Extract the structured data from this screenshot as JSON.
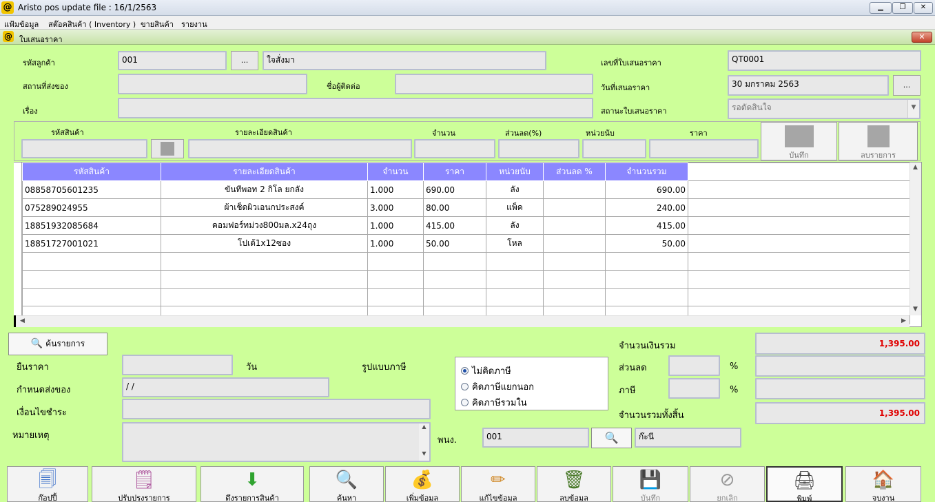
{
  "app": {
    "title": "Aristo pos  update file : 16/1/2563",
    "icon_glyph": "@",
    "window_controls": [
      "minimize",
      "restore",
      "close"
    ]
  },
  "menu": [
    "แฟ้มข้อมูล",
    "สต๊อคสินค้า ( Inventory )",
    "ขายสินค้า",
    "รายงาน"
  ],
  "child_window": {
    "title": "ใบเสนอราคา",
    "close_glyph": "✕"
  },
  "header": {
    "customer_code_label": "รหัสลูกค้า",
    "customer_code": "001",
    "customer_browse": "...",
    "customer_name": "ใจสั่งมา",
    "quote_no_label": "เลขที่ใบเสนอราคา",
    "quote_no": "QT0001",
    "delivery_place_label": "สถานที่ส่งของ",
    "delivery_place": "",
    "contact_label": "ชื่อผู้ติดต่อ",
    "contact": "",
    "quote_date_label": "วันที่เสนอราคา",
    "quote_date": "30 มกราคม 2563",
    "date_browse": "...",
    "subject_label": "เรื่อง",
    "subject": "",
    "status_label": "สถานะใบเสนอราคา",
    "status": "รอตัดสินใจ"
  },
  "entry": {
    "code_label": "รหัสสินค้า",
    "desc_label": "รายละเอียดสินค้า",
    "qty_label": "จำนวน",
    "discount_label": "ส่วนลด(%)",
    "unit_label": "หน่วยนับ",
    "price_label": "ราคา",
    "save_label": "บันทึก",
    "delete_label": "ลบรายการ"
  },
  "grid": {
    "columns": [
      "รหัสสินค้า",
      "รายละเอียดสินค้า",
      "จำนวน",
      "ราคา",
      "หน่วยนับ",
      "ส่วนลด %",
      "จำนวนรวม"
    ],
    "rows": [
      [
        "08858705601235",
        "ขันทีพอท 2 กิโล ยกลัง",
        "1.000",
        "690.00",
        "ลัง",
        "",
        "690.00"
      ],
      [
        "075289024955",
        "ผ้าเช็ดผิวเอนกประสงค์",
        "3.000",
        "80.00",
        "แพ็ค",
        "",
        "240.00"
      ],
      [
        "18851932085684",
        "คอมฟอร์ทม่วง800มล.x24ถุง",
        "1.000",
        "415.00",
        "ลัง",
        "",
        "415.00"
      ],
      [
        "18851727001021",
        "โปเต้1x12ซอง",
        "1.000",
        "50.00",
        "โหล",
        "",
        "50.00"
      ],
      [
        "",
        "",
        "",
        "",
        "",
        "",
        ""
      ],
      [
        "",
        "",
        "",
        "",
        "",
        "",
        ""
      ],
      [
        "",
        "",
        "",
        "",
        "",
        "",
        ""
      ],
      [
        "",
        "",
        "",
        "",
        "",
        "",
        ""
      ]
    ]
  },
  "lower": {
    "find_items_label": "ค้นรายการ",
    "price_valid_label": "ยืนราคา",
    "price_valid": "",
    "days_label": "วัน",
    "tax_type_label": "รูปแบบภาษี",
    "delivery_due_label": "กำหนดส่งของ",
    "delivery_due": " /  /",
    "payment_terms_label": "เงื่อนไขชำระ",
    "payment_terms": "",
    "remark_label": "หมายเหตุ",
    "remark": "",
    "tax_options": [
      "ไม่คิดภาษี",
      "คิดภาษีแยกนอก",
      "คิดภาษีรวมใน"
    ],
    "tax_selected": 0,
    "employee_label": "พนง.",
    "employee_code": "001",
    "employee_name": "ก๊ะนี",
    "total_label": "จำนวนเงินรวม",
    "total": "1,395.00",
    "discount_label": "ส่วนลด",
    "discount_pct": "",
    "discount_amt": "",
    "vat_label": "ภาษี",
    "vat_pct": "",
    "vat_amt": "",
    "percent": "%",
    "grand_total_label": "จำนวนรวมทั้งสิ้น",
    "grand_total": "1,395.00"
  },
  "toolbar": [
    {
      "label": "ก๊อปปี้",
      "icon": "copy-icon",
      "glyph": "🗐",
      "enabled": true
    },
    {
      "label": "ปรับปรุงรายการ",
      "icon": "edit-list-icon",
      "glyph": "🗒",
      "enabled": true
    },
    {
      "label": "ดึงรายการสินค้า",
      "icon": "down-arrow-icon",
      "glyph": "⬇",
      "enabled": true
    },
    {
      "label": "ค้นหา",
      "icon": "search-icon",
      "glyph": "🔍",
      "enabled": true
    },
    {
      "label": "เพิ่มข้อมูล",
      "icon": "add-data-icon",
      "glyph": "💰",
      "enabled": true
    },
    {
      "label": "แก้ไขข้อมูล",
      "icon": "pencil-icon",
      "glyph": "✏",
      "enabled": true
    },
    {
      "label": "ลบข้อมูล",
      "icon": "trash-icon",
      "glyph": "🗑",
      "enabled": true
    },
    {
      "label": "บันทึก",
      "icon": "save-icon",
      "glyph": "💾",
      "enabled": false
    },
    {
      "label": "ยกเลิก",
      "icon": "cancel-icon",
      "glyph": "⊘",
      "enabled": false
    },
    {
      "label": "พิมพ์",
      "icon": "printer-icon",
      "glyph": "🖨",
      "enabled": true
    },
    {
      "label": "จบงาน",
      "icon": "home-icon",
      "glyph": "🏠",
      "enabled": true
    }
  ],
  "colors": {
    "form_bg": "#cdff99",
    "grid_header": "#8b87ff",
    "total_red": "#e00000"
  }
}
